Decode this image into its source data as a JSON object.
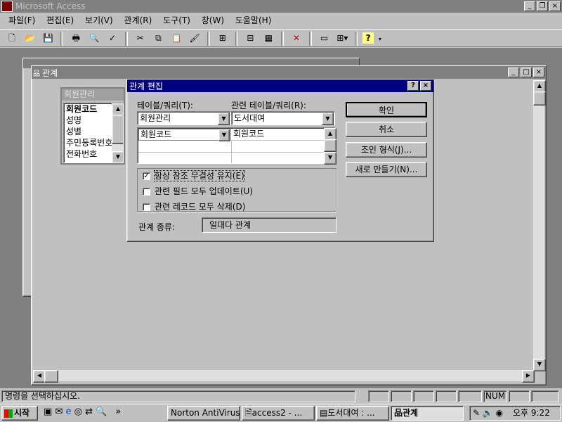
{
  "app": {
    "title": "Microsoft Access"
  },
  "menu": [
    "파일(F)",
    "편집(E)",
    "보기(V)",
    "관계(R)",
    "도구(T)",
    "창(W)",
    "도움말(H)"
  ],
  "child_window": {
    "title": "관계"
  },
  "table_box": {
    "title": "회원관리",
    "fields": [
      "회원코드",
      "성명",
      "성별",
      "주민등록번호",
      "전화번호"
    ]
  },
  "dialog": {
    "title": "관계 편집",
    "help": "?",
    "close": "×",
    "table_label": "테이블/쿼리(T):",
    "related_label": "관련 테이블/쿼리(R):",
    "table_value": "회원관리",
    "related_value": "도서대여",
    "grid_left": "회원코드",
    "grid_right": "회원코드",
    "ok": "확인",
    "cancel": "취소",
    "join": "조인 형식(J)...",
    "new": "새로 만들기(N)...",
    "enforce": "항상 참조 무결성 유지(E)",
    "cascade_update": "관련 필드 모두 업데이트(U)",
    "cascade_delete": "관련 레코드 모두 삭제(D)",
    "rel_type_label": "관계 종류:",
    "rel_type_value": "일대다 관계",
    "enforce_checked": true,
    "cascade_update_checked": false,
    "cascade_delete_checked": false
  },
  "status": {
    "text": "명령을 선택하십시오.",
    "num": "NUM"
  },
  "taskbar": {
    "start": "시작",
    "tasks": [
      "Norton AntiVirus",
      "access2 - ...",
      "도서대여 : ...",
      "관계"
    ],
    "clock": "오후 9:22"
  }
}
